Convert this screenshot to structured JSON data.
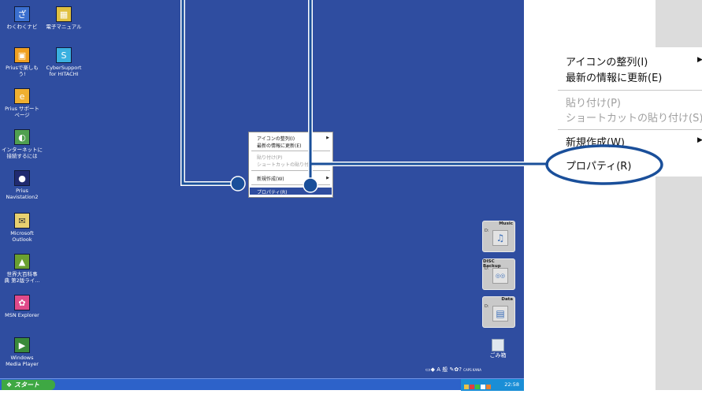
{
  "desktop_icons": [
    {
      "label": "わくわくナビ",
      "icon": "wakuwaku-navi-icon",
      "color": "#3a6fcf"
    },
    {
      "label": "電子マニュアル",
      "icon": "electronic-manual-icon",
      "color": "#e0c040"
    },
    {
      "label": "Priusで楽しも\nう!",
      "icon": "prius-enjoy-icon",
      "color": "#f0a020"
    },
    {
      "label": "CyberSupport\nfor HITACHI",
      "icon": "cybersupport-icon",
      "color": "#3ab0e0"
    },
    {
      "label": "Prius サポート\nページ",
      "icon": "prius-support-icon",
      "color": "#f0b030"
    },
    {
      "label": "インターネットに\n接続するには",
      "icon": "internet-connect-icon",
      "color": "#50a050"
    },
    {
      "label": "Prius\nNavistation2",
      "icon": "navistation-icon",
      "color": "#202a70"
    },
    {
      "label": "Microsoft\nOutlook",
      "icon": "outlook-icon",
      "color": "#e8d070"
    },
    {
      "label": "世界大百科事\n典 第2版ライ...",
      "icon": "encyclopedia-icon",
      "color": "#6aa030"
    },
    {
      "label": "MSN Explorer",
      "icon": "msn-explorer-icon",
      "color": "#e04a8a"
    },
    {
      "label": "Windows\nMedia Player",
      "icon": "media-player-icon",
      "color": "#3a8a3a"
    }
  ],
  "widgets": [
    {
      "title": "Music",
      "drive": "D:",
      "icon": "music-note-icon",
      "glyph": "♫"
    },
    {
      "title": "DISC Backup",
      "drive": "D:",
      "icon": "disc-backup-icon",
      "glyph": "◎◎"
    },
    {
      "title": "Data",
      "drive": "D:",
      "icon": "data-files-icon",
      "glyph": "▤"
    }
  ],
  "trash": {
    "label": "ごみ箱",
    "icon": "recycle-bin-icon"
  },
  "taskbar": {
    "start_label": "スタート",
    "start_icon": "windows-logo-icon",
    "clock": "22:58",
    "language_bar": "A 般",
    "caps_kana": "CAPS KANA"
  },
  "context_menu": {
    "items": [
      {
        "label": "アイコンの整列(I)",
        "enabled": true,
        "submenu": true
      },
      {
        "label": "最新の情報に更新(E)",
        "enabled": true,
        "submenu": false
      },
      {
        "label": "貼り付け(P)",
        "enabled": false,
        "submenu": false
      },
      {
        "label": "ショートカットの貼り付け(S)",
        "enabled": false,
        "submenu": false
      },
      {
        "label": "新規作成(W)",
        "enabled": true,
        "submenu": true
      },
      {
        "label": "プロパティ(R)",
        "enabled": true,
        "submenu": false,
        "highlighted": true
      }
    ]
  },
  "colors": {
    "desktop": "#2f4da0",
    "callout": "#1a4f9a",
    "taskbar": "#2d62c9",
    "start": "#3ea843"
  }
}
